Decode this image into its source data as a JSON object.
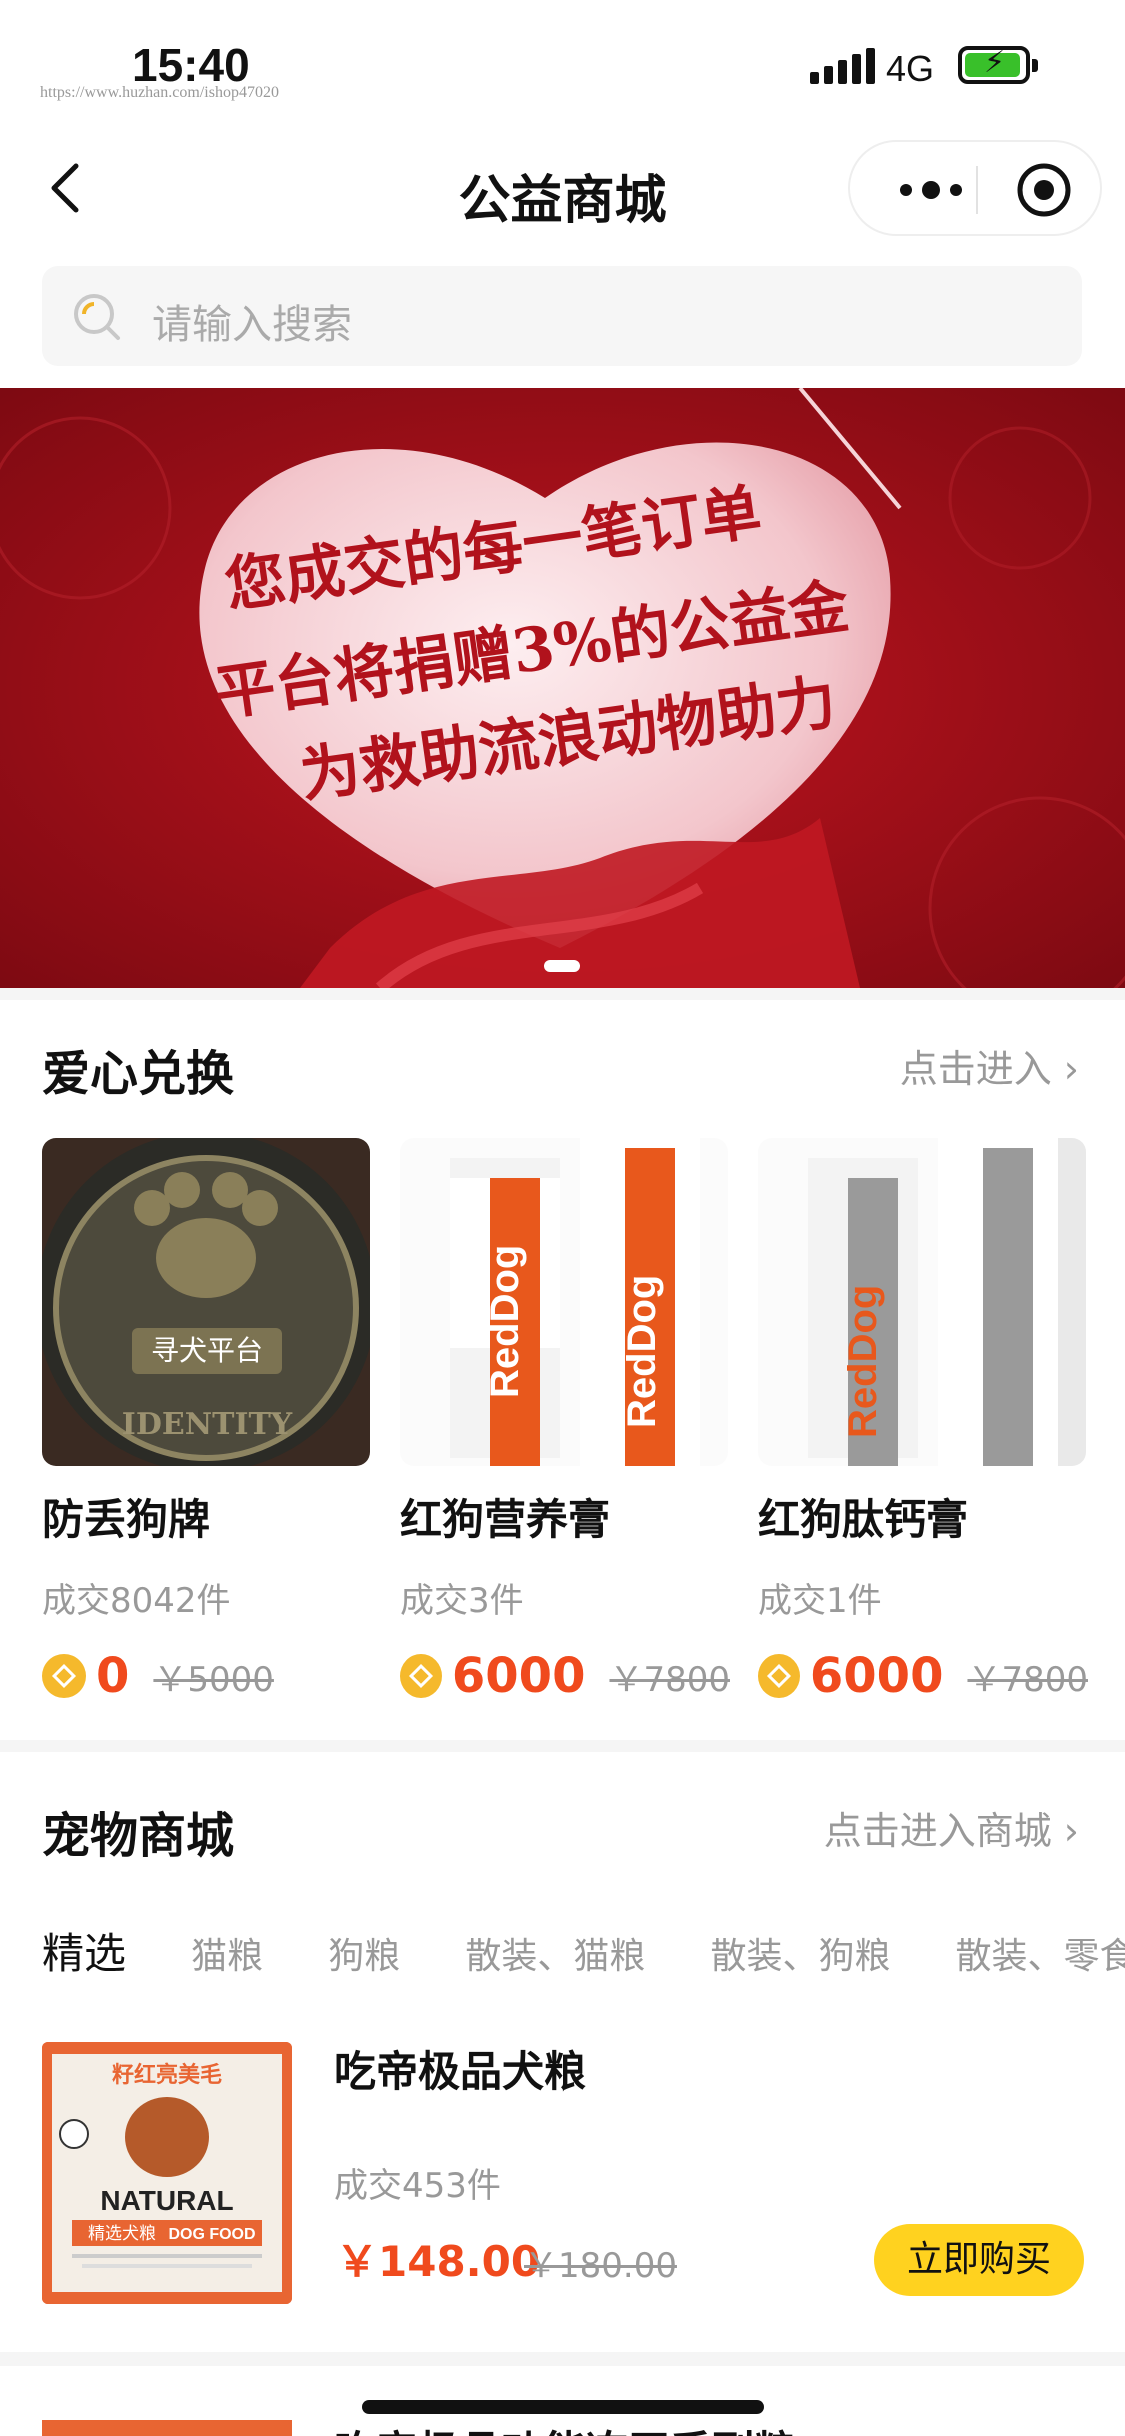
{
  "status_bar": {
    "time": "15:40",
    "network": "4G",
    "watermark_url": "https://www.huzhan.com/ishop47020"
  },
  "nav": {
    "title": "公益商城"
  },
  "search": {
    "placeholder": "请输入搜索"
  },
  "banner": {
    "lines": [
      "您成交的每一笔订单",
      "平台将捐赠3%的公益金",
      "为救助流浪动物助力"
    ],
    "colors": {
      "bg": "#a3111b",
      "heart": "#f7d6da"
    }
  },
  "love_section": {
    "title": "爱心兑换",
    "link": "点击进入",
    "items": [
      {
        "name": "防丢狗牌",
        "sold": "成交8042件",
        "coin_price": "0",
        "orig_price": "￥5000",
        "image": "dog-tag-photo",
        "tag_text": "寻犬平台",
        "tag_word": "IDENTITY"
      },
      {
        "name": "红狗营养膏",
        "sold": "成交3件",
        "coin_price": "6000",
        "orig_price": "￥7800",
        "image": "reddog-orange-tube",
        "brand": "RedDog"
      },
      {
        "name": "红狗肽钙膏",
        "sold": "成交1件",
        "coin_price": "6000",
        "orig_price": "￥7800",
        "image": "reddog-gray-tube",
        "brand": "RedDog"
      }
    ]
  },
  "shop_section": {
    "title": "宠物商城",
    "link": "点击进入商城",
    "tabs": [
      "精选",
      "猫粮",
      "狗粮",
      "散装、猫粮",
      "散装、狗粮",
      "散装、零食"
    ],
    "products": [
      {
        "name": "吃帝极品犬粮",
        "sold": "成交453件",
        "price": "￥148.00",
        "orig_price": "￥180.00",
        "buy_label": "立即购买",
        "pack_top": "籽红亮美毛",
        "pack_brand": "NATURAL",
        "pack_sub": "精选犬粮",
        "pack_en": "DOG FOOD"
      }
    ],
    "next_product_name": "吃帝极品功能冻干系列粮"
  },
  "colors": {
    "accent": "#f04a1d",
    "buy_button": "#ffd21f",
    "coin": "#f5b92c"
  }
}
